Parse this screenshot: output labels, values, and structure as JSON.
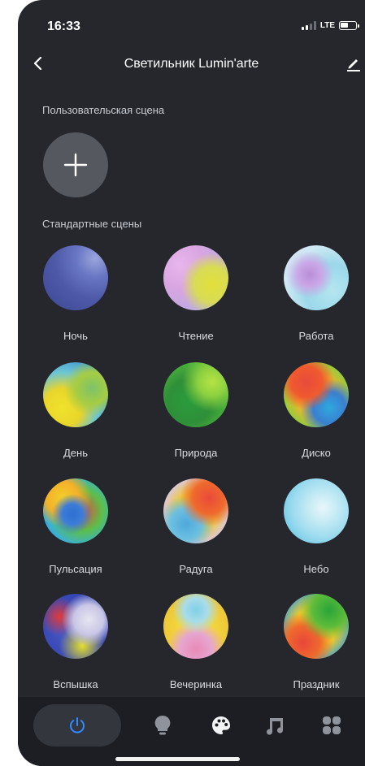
{
  "status_bar": {
    "time": "16:33",
    "network": "LTE"
  },
  "header": {
    "title": "Светильник Lumin'arte"
  },
  "custom_section": {
    "title": "Пользовательская сцена"
  },
  "standard_section": {
    "title": "Стандартные сцены"
  },
  "scenes": [
    {
      "label": "Ночь"
    },
    {
      "label": "Чтение"
    },
    {
      "label": "Работа"
    },
    {
      "label": "День"
    },
    {
      "label": "Природа"
    },
    {
      "label": "Диско"
    },
    {
      "label": "Пульсация"
    },
    {
      "label": "Радуга"
    },
    {
      "label": "Небо"
    },
    {
      "label": "Вспышка"
    },
    {
      "label": "Вечеринка"
    },
    {
      "label": "Праздник"
    }
  ],
  "tab_bar": {
    "items": [
      {
        "icon": "power-icon",
        "selected": true
      },
      {
        "icon": "bulb-icon",
        "selected": false
      },
      {
        "icon": "palette-icon",
        "selected": false
      },
      {
        "icon": "music-icon",
        "selected": false
      },
      {
        "icon": "grid-icon",
        "selected": false
      }
    ]
  },
  "colors": {
    "background": "#25272d",
    "tab_bar": "#1d1e23",
    "accent": "#2f8bff",
    "text": "#ffffff"
  }
}
